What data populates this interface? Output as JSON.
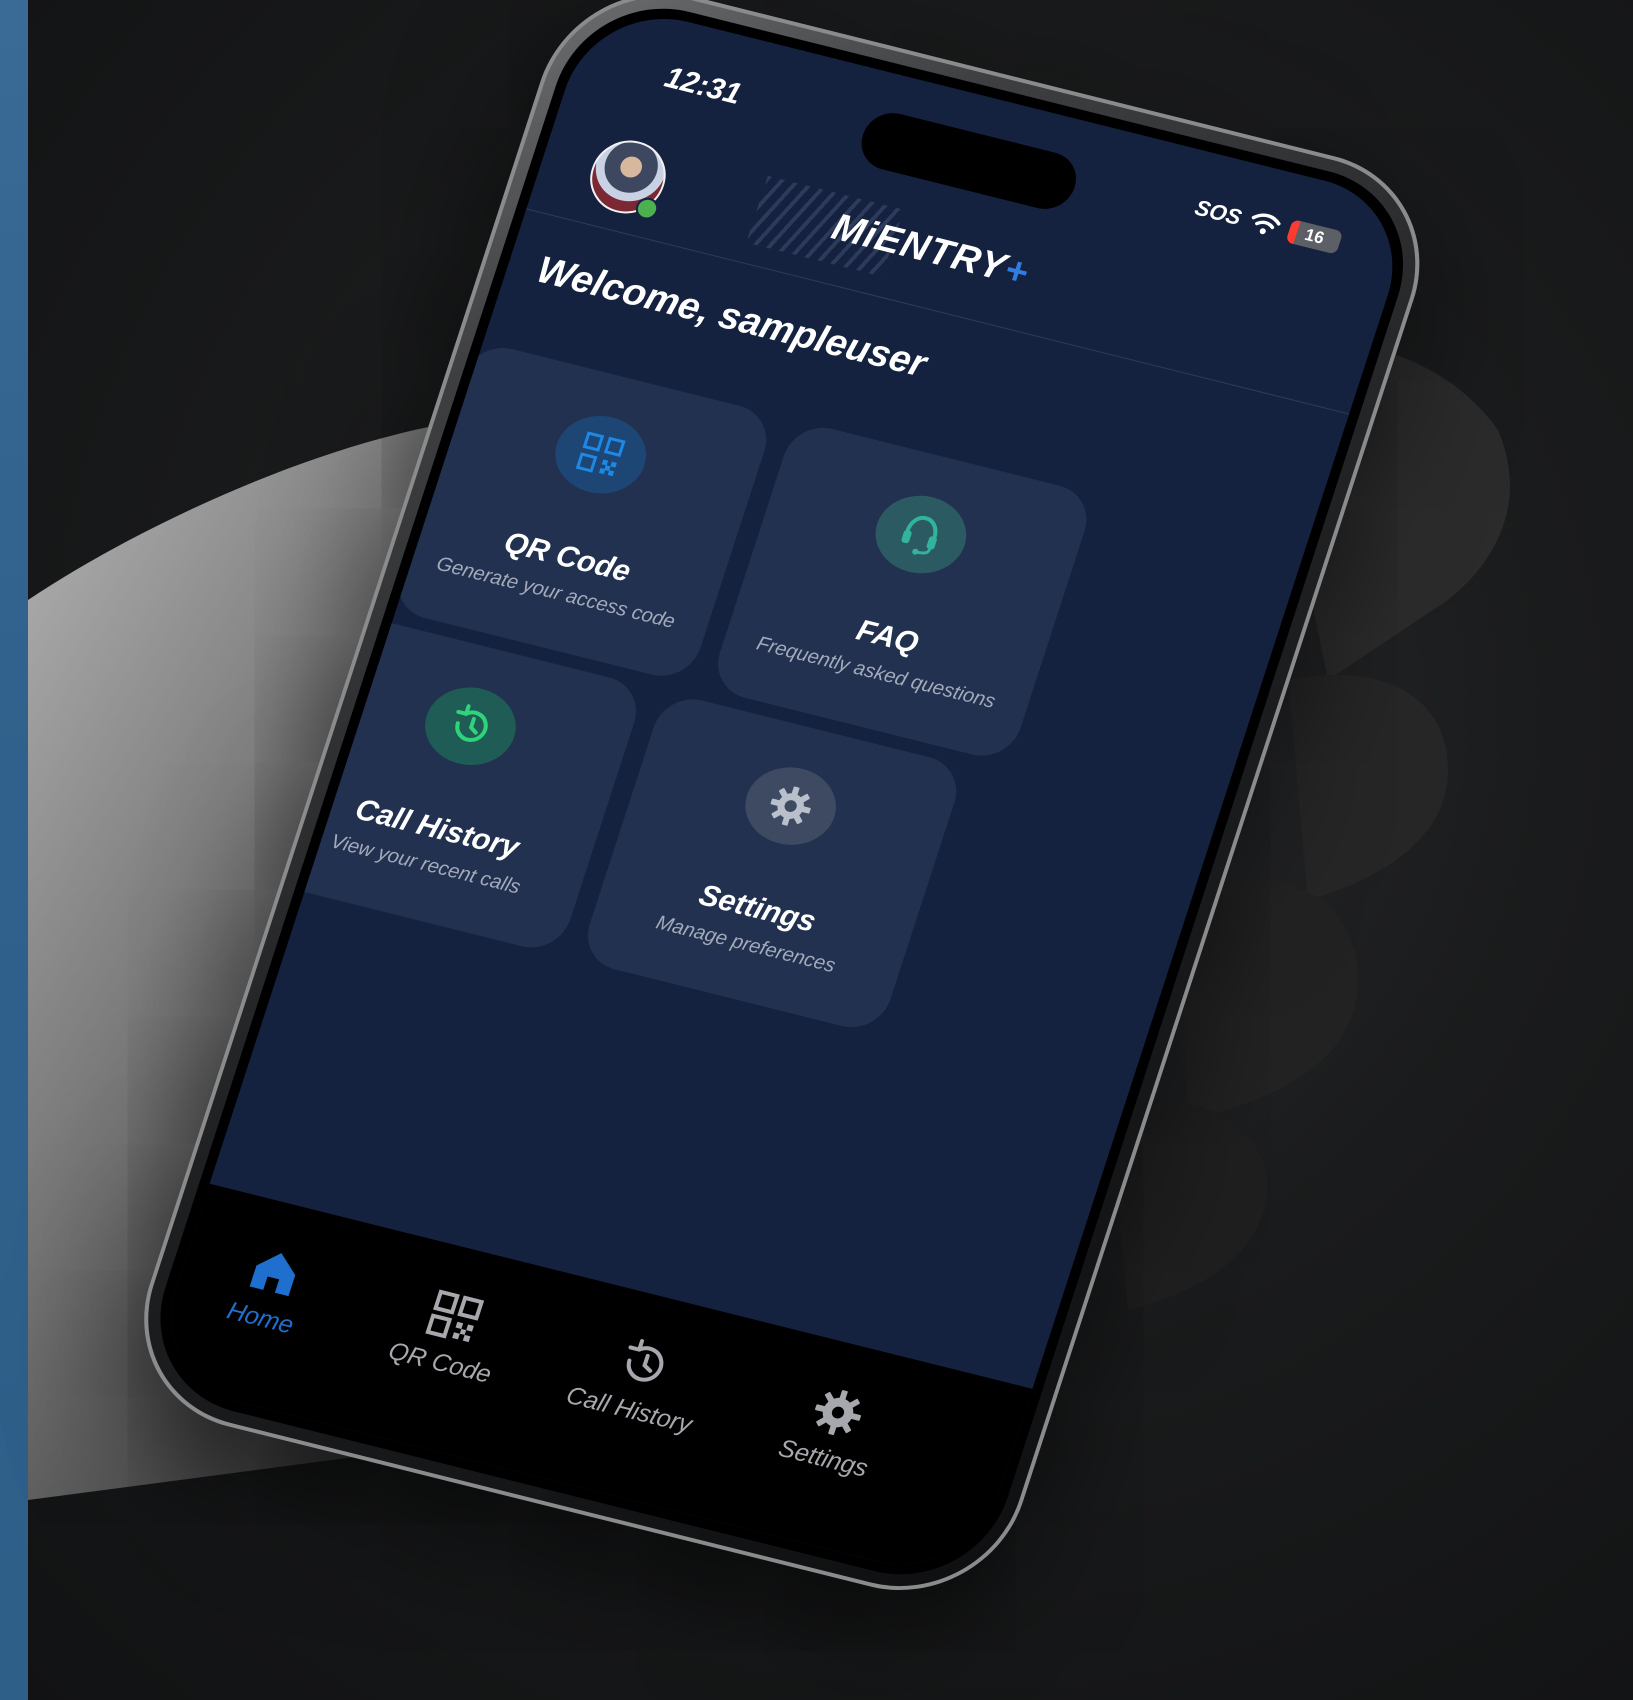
{
  "status_bar": {
    "time": "12:31",
    "sos": "SOS",
    "battery": "16"
  },
  "header": {
    "logo": "MiENTRY",
    "logo_plus": "+"
  },
  "welcome": "Welcome, sampleuser",
  "cards": [
    {
      "title": "QR Code",
      "subtitle": "Generate your access code",
      "icon": "qr-code-icon"
    },
    {
      "title": "FAQ",
      "subtitle": "Frequently asked questions",
      "icon": "headset-icon"
    },
    {
      "title": "Call History",
      "subtitle": "View your recent calls",
      "icon": "history-icon"
    },
    {
      "title": "Settings",
      "subtitle": "Manage preferences",
      "icon": "gear-icon"
    }
  ],
  "nav": [
    {
      "label": "Home",
      "icon": "home-icon",
      "active": true
    },
    {
      "label": "QR Code",
      "icon": "qr-code-icon",
      "active": false
    },
    {
      "label": "Call History",
      "icon": "history-icon",
      "active": false
    },
    {
      "label": "Settings",
      "icon": "gear-icon",
      "active": false
    }
  ],
  "colors": {
    "screen_bg": "#14213f",
    "card_bg": "#22314f",
    "accent": "#1f6fce",
    "side_strip": "#2f618c"
  }
}
